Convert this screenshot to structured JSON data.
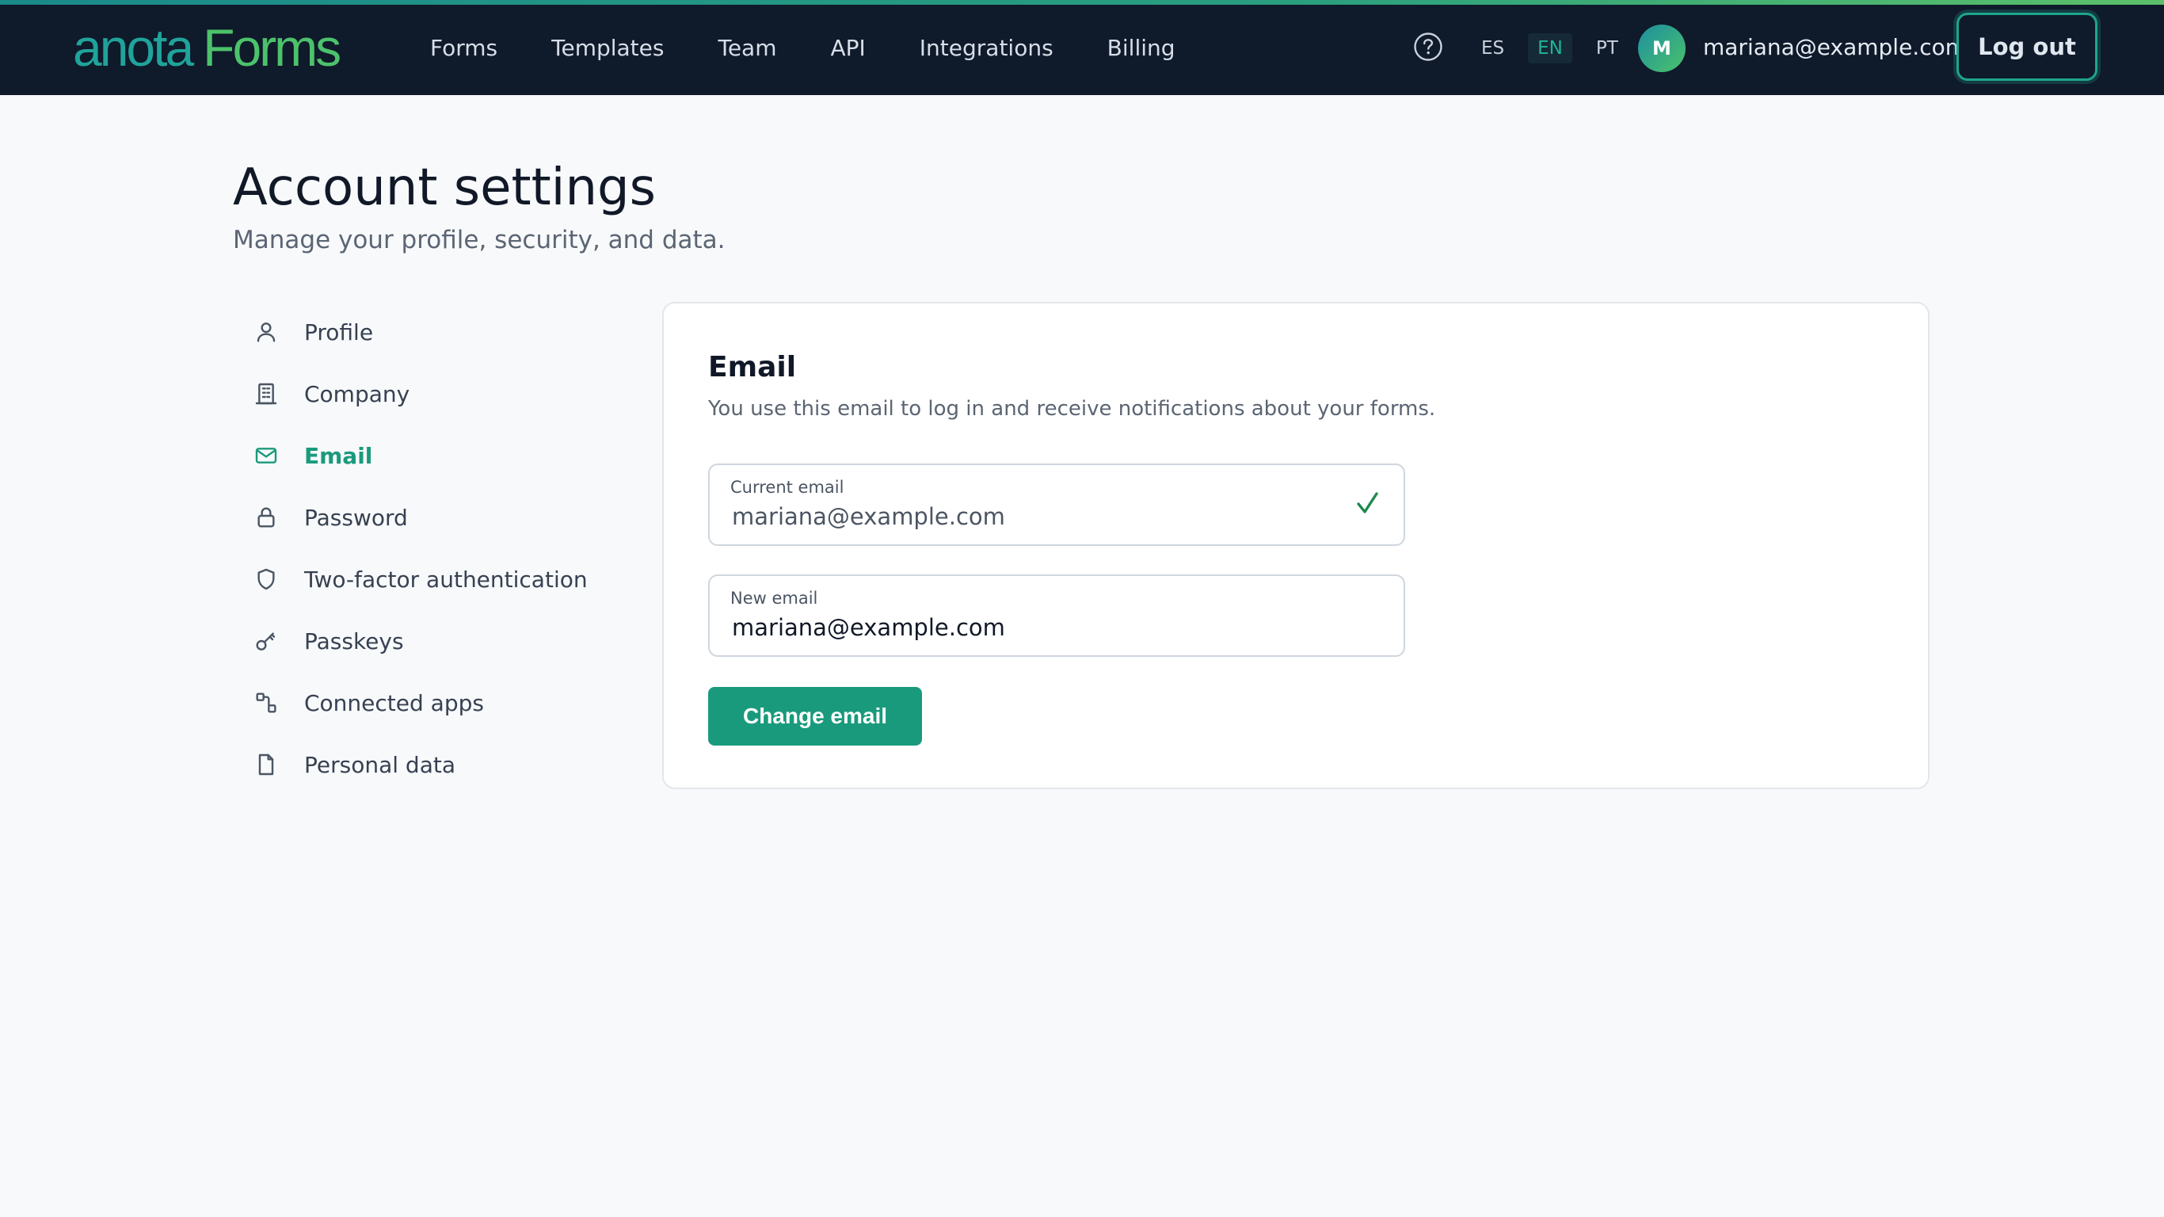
{
  "brand": {
    "part1": "anota",
    "part2": "Forms"
  },
  "nav": [
    {
      "label": "Forms"
    },
    {
      "label": "Templates"
    },
    {
      "label": "Team"
    },
    {
      "label": "API"
    },
    {
      "label": "Integrations"
    },
    {
      "label": "Billing"
    }
  ],
  "header": {
    "languages": [
      "ES",
      "EN",
      "PT"
    ],
    "active_language": "EN",
    "avatar_initial": "M",
    "user_email": "mariana@example.com",
    "logout_label": "Log out"
  },
  "page": {
    "title": "Account settings",
    "subtitle": "Manage your profile, security, and data."
  },
  "sidebar": {
    "items": [
      {
        "label": "Profile",
        "icon": "user-icon"
      },
      {
        "label": "Company",
        "icon": "building-icon"
      },
      {
        "label": "Email",
        "icon": "mail-icon",
        "active": true
      },
      {
        "label": "Password",
        "icon": "lock-icon"
      },
      {
        "label": "Two-factor authentication",
        "icon": "shield-icon"
      },
      {
        "label": "Passkeys",
        "icon": "key-icon"
      },
      {
        "label": "Connected apps",
        "icon": "apps-icon"
      },
      {
        "label": "Personal data",
        "icon": "file-icon"
      }
    ]
  },
  "email_card": {
    "title": "Email",
    "description": "You use this email to log in and receive notifications about your forms.",
    "current_email": {
      "label": "Current email",
      "value": "mariana@example.com"
    },
    "new_email": {
      "label": "New email",
      "value": "mariana@example.com"
    },
    "submit_label": "Change email"
  },
  "colors": {
    "header_bg": "#0f1a2b",
    "accent": "#1a9a7c",
    "page_bg": "#f7f9fb"
  }
}
